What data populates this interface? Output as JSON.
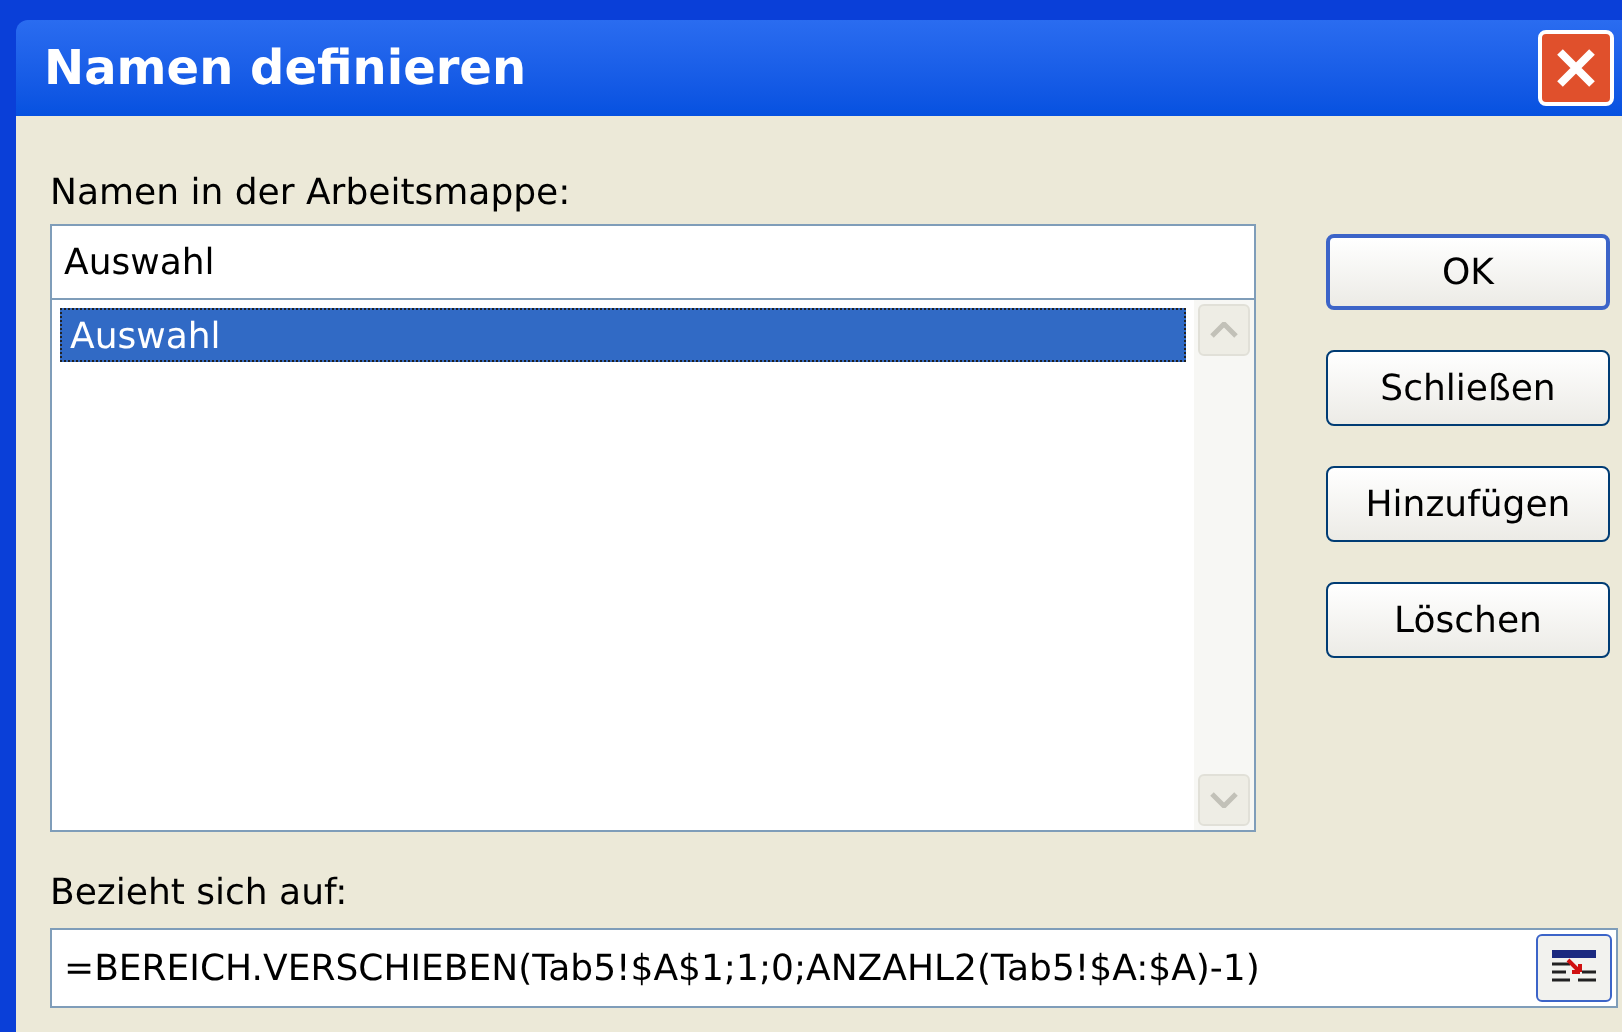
{
  "window": {
    "title": "Namen definieren"
  },
  "names_label": "Namen in der Arbeitsmappe:",
  "name_field": {
    "value": "Auswahl"
  },
  "names_list": [
    {
      "label": "Auswahl",
      "selected": true
    }
  ],
  "buttons": [
    {
      "label": "OK",
      "default": true
    },
    {
      "label": "Schließen",
      "default": false
    },
    {
      "label": "Hinzufügen",
      "default": false
    },
    {
      "label": "Löschen",
      "default": false
    }
  ],
  "refers_label": "Bezieht sich auf:",
  "refers_field": {
    "value": "=BEREICH.VERSCHIEBEN(Tab5!$A$1;1;0;ANZAHL2(Tab5!$A:$A)-1)"
  }
}
